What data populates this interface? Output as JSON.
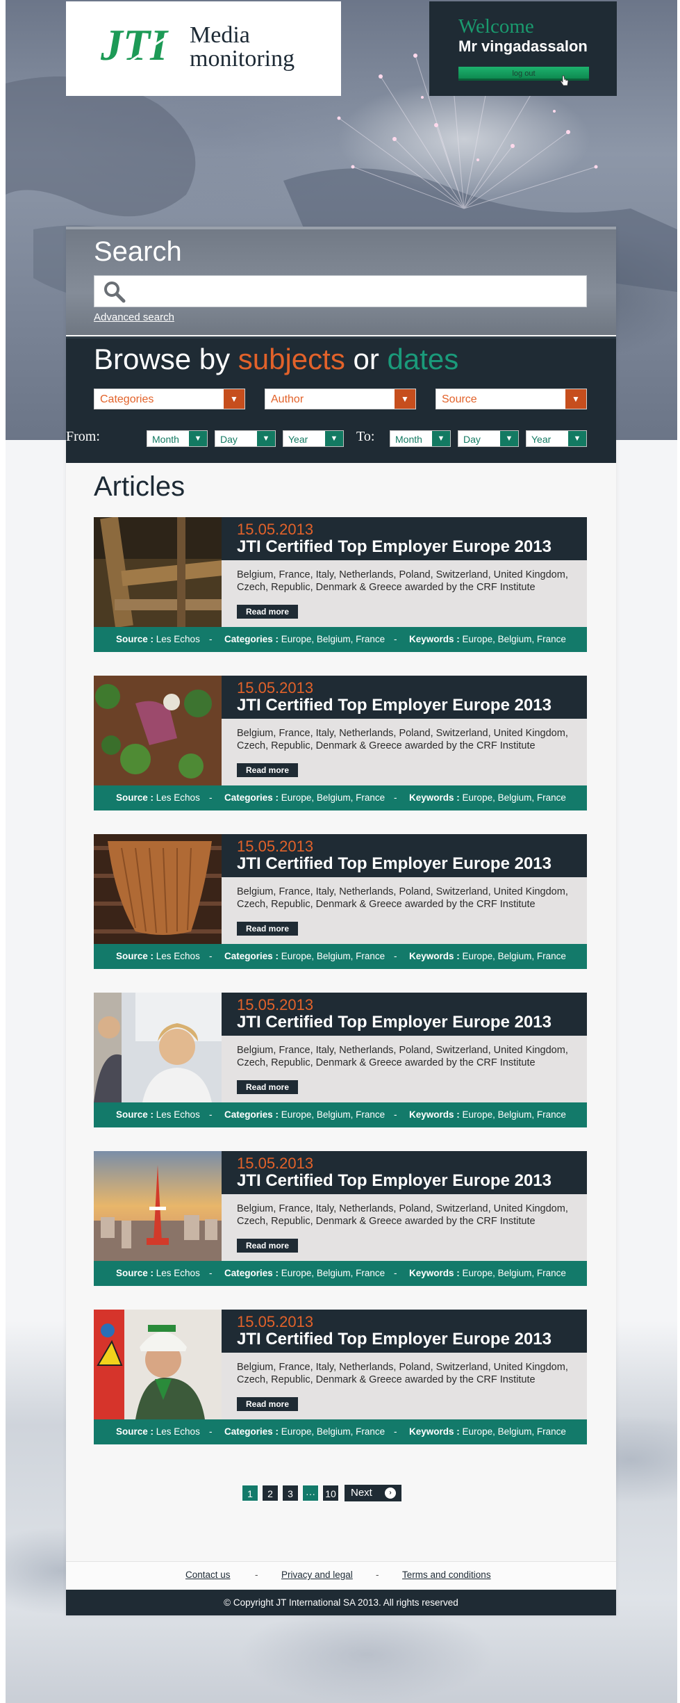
{
  "header": {
    "logo_mark": "JTI",
    "logo_line1": "Media",
    "logo_line2": "monitoring",
    "welcome_title": "Welcome",
    "welcome_user": "Mr vingadassalon",
    "logout_label": "log out"
  },
  "search": {
    "title": "Search",
    "input_value": "",
    "advanced_label": "Advanced search"
  },
  "browse": {
    "title_part1": "Browse by ",
    "title_subjects": "subjects",
    "title_or": " or ",
    "title_dates": "dates",
    "filters": [
      "Categories",
      "Author",
      "Source"
    ],
    "from_label": "From:",
    "to_label": "To:",
    "date_fields": [
      "Month",
      "Day",
      "Year"
    ]
  },
  "articles": {
    "heading": "Articles",
    "read_more_label": "Read more",
    "source_label": "Source :",
    "categories_label": "Categories :",
    "keywords_label": "Keywords :",
    "separator": "-",
    "items": [
      {
        "date": "15.05.2013",
        "title": "JTI Certified Top Employer Europe 2013",
        "description": "Belgium, France, Italy, Netherlands, Poland, Switzerland, United Kingdom, Czech, Republic, Denmark & Greece awarded by the CRF Institute",
        "source": "Les Echos",
        "categories": "Europe, Belgium, France",
        "keywords": "Europe, Belgium, France"
      },
      {
        "date": "15.05.2013",
        "title": "JTI Certified Top Employer Europe 2013",
        "description": "Belgium, France, Italy, Netherlands, Poland, Switzerland, United Kingdom, Czech, Republic, Denmark & Greece awarded by the CRF Institute",
        "source": "Les Echos",
        "categories": "Europe, Belgium, France",
        "keywords": "Europe, Belgium, France"
      },
      {
        "date": "15.05.2013",
        "title": "JTI Certified Top Employer Europe 2013",
        "description": "Belgium, France, Italy, Netherlands, Poland, Switzerland, United Kingdom, Czech, Republic, Denmark & Greece awarded by the CRF Institute",
        "source": "Les Echos",
        "categories": "Europe, Belgium, France",
        "keywords": "Europe, Belgium, France"
      },
      {
        "date": "15.05.2013",
        "title": "JTI Certified Top Employer Europe 2013",
        "description": "Belgium, France, Italy, Netherlands, Poland, Switzerland, United Kingdom, Czech, Republic, Denmark & Greece awarded by the CRF Institute",
        "source": "Les Echos",
        "categories": "Europe, Belgium, France",
        "keywords": "Europe, Belgium, France"
      },
      {
        "date": "15.05.2013",
        "title": "JTI Certified Top Employer Europe 2013",
        "description": "Belgium, France, Italy, Netherlands, Poland, Switzerland, United Kingdom, Czech, Republic, Denmark & Greece awarded by the CRF Institute",
        "source": "Les Echos",
        "categories": "Europe, Belgium, France",
        "keywords": "Europe, Belgium, France"
      },
      {
        "date": "15.05.2013",
        "title": "JTI Certified Top Employer Europe 2013",
        "description": "Belgium, France, Italy, Netherlands, Poland, Switzerland, United Kingdom, Czech, Republic, Denmark & Greece awarded by the CRF Institute",
        "source": "Les Echos",
        "categories": "Europe, Belgium, France",
        "keywords": "Europe, Belgium, France"
      }
    ]
  },
  "pagination": {
    "pages": [
      "1",
      "2",
      "3",
      "···",
      "10"
    ],
    "current": "1",
    "next_label": "Next"
  },
  "footer": {
    "links": [
      "Contact us",
      "Privacy and legal",
      "Terms and conditions"
    ],
    "separator": "-",
    "copyright": "© Copyright JT International SA 2013. All rights reserved"
  },
  "colors": {
    "dark": "#1f2b34",
    "teal": "#137a6a",
    "orange": "#e2622a",
    "green": "#1a9a6e"
  }
}
